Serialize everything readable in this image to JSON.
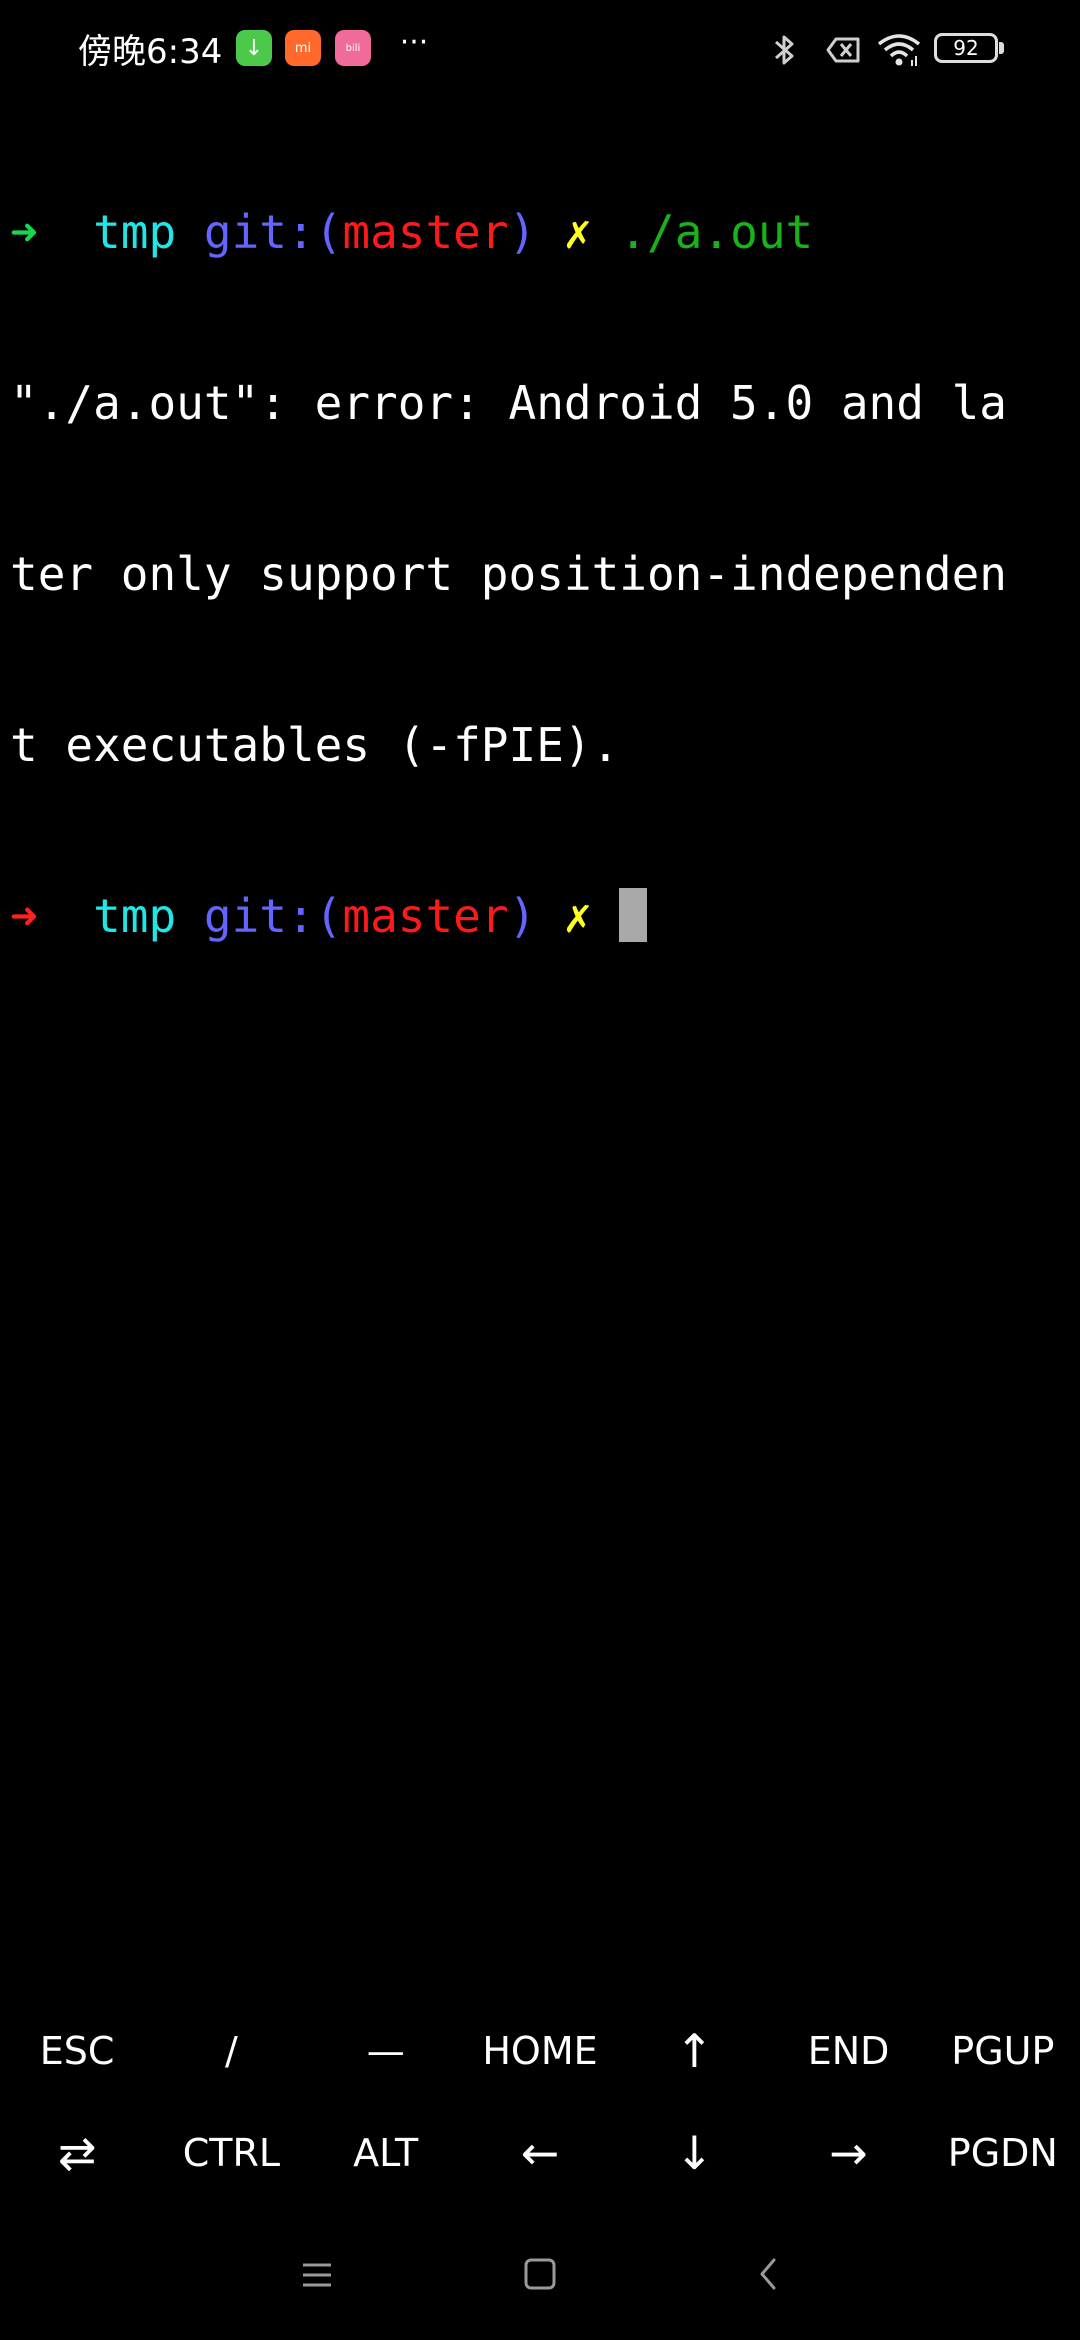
{
  "status_bar": {
    "time": "傍晚6:34",
    "notification_icons": [
      "download-icon",
      "mi-store-icon",
      "bilibili-icon"
    ],
    "more_indicator": "···",
    "battery_level": "92",
    "system_icons": [
      "bluetooth-icon",
      "no-sim-icon",
      "wifi-icon",
      "battery-icon"
    ]
  },
  "terminal": {
    "line1": {
      "arrow": "➜",
      "dir": "tmp",
      "git_prefix": "git:(",
      "branch": "master",
      "git_suffix": ")",
      "dirty_mark": "✗",
      "command": "./a.out"
    },
    "output": [
      "\"./a.out\": error: Android 5.0 and la",
      "ter only support position-independen",
      "t executables (-fPIE)."
    ],
    "prompt": {
      "arrow": "➜",
      "dir": "tmp",
      "git_prefix": "git:(",
      "branch": "master",
      "git_suffix": ")",
      "dirty_mark": "✗"
    },
    "colors": {
      "arrow_success": "#18d850",
      "arrow_fail": "#ff2020",
      "dir": "#21e6e6",
      "git": "#6464ff",
      "branch": "#ff1a1a",
      "dirty": "#ffff20",
      "command": "#19b319",
      "cursor": "#a9a9a9"
    }
  },
  "extra_keys": {
    "row1": [
      {
        "name": "esc-key",
        "label": "ESC"
      },
      {
        "name": "slash-key",
        "label": "/"
      },
      {
        "name": "dash-key",
        "label": "—"
      },
      {
        "name": "home-key",
        "label": "HOME"
      },
      {
        "name": "up-arrow-key",
        "label": "↑"
      },
      {
        "name": "end-key",
        "label": "END"
      },
      {
        "name": "pgup-key",
        "label": "PGUP"
      }
    ],
    "row2": [
      {
        "name": "tab-key",
        "label": "⇄"
      },
      {
        "name": "ctrl-key",
        "label": "CTRL"
      },
      {
        "name": "alt-key",
        "label": "ALT"
      },
      {
        "name": "left-arrow-key",
        "label": "←"
      },
      {
        "name": "down-arrow-key",
        "label": "↓"
      },
      {
        "name": "right-arrow-key",
        "label": "→"
      },
      {
        "name": "pgdn-key",
        "label": "PGDN"
      }
    ]
  },
  "nav_bar": {
    "buttons": [
      "menu-icon",
      "home-icon",
      "back-icon"
    ]
  }
}
